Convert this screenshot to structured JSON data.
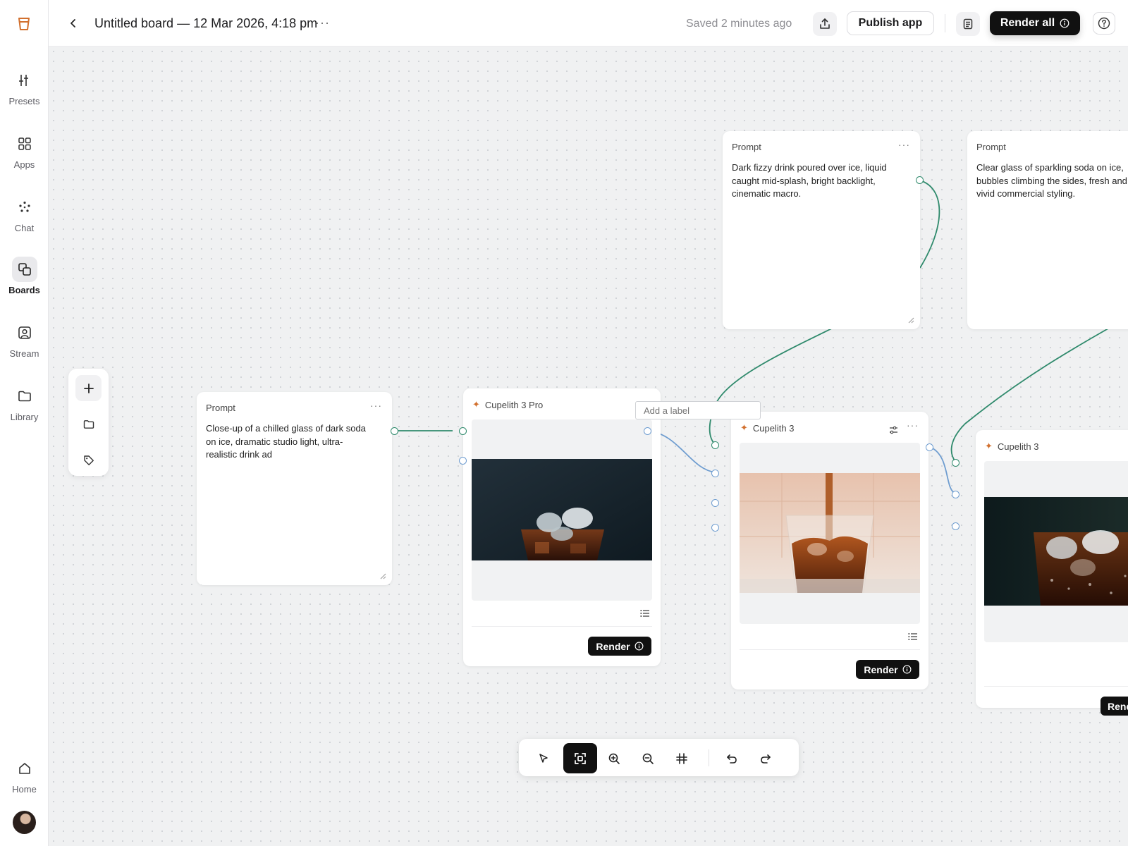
{
  "app": {
    "brand_color": "#d2702e",
    "accent_dark": "#111111",
    "wire_green": "#2f8a6c",
    "wire_blue": "#6f9dd0"
  },
  "sidebar": {
    "logo_icon": "cup-logo-icon",
    "items": [
      {
        "id": "presets",
        "label": "Presets",
        "icon": "sliders-icon",
        "active": false
      },
      {
        "id": "apps",
        "label": "Apps",
        "icon": "grid-icon",
        "active": false
      },
      {
        "id": "chat",
        "label": "Chat",
        "icon": "dots-cluster-icon",
        "active": false
      },
      {
        "id": "boards",
        "label": "Boards",
        "icon": "boards-icon",
        "active": true
      },
      {
        "id": "stream",
        "label": "Stream",
        "icon": "person-frame-icon",
        "active": false
      },
      {
        "id": "library",
        "label": "Library",
        "icon": "folder-icon",
        "active": false
      }
    ],
    "home": {
      "label": "Home",
      "icon": "home-icon"
    },
    "avatar": "user-avatar"
  },
  "header": {
    "board_title": "Untitled board — 12 Mar 2026, 4:18 pm",
    "title_menu": "···",
    "saved_status": "Saved 2 minutes ago",
    "publish_label": "Publish app",
    "render_all_label": "Render all"
  },
  "canvas": {
    "label_input": {
      "placeholder": "Add a label"
    },
    "prompt_main": {
      "header": "Prompt",
      "lines": [
        "Close-up of a chilled glass of dark soda",
        "on ice, dramatic studio light, ultra-",
        "realistic drink ad"
      ]
    },
    "prompt_top1": {
      "header": "Prompt",
      "lines": [
        "Dark fizzy drink poured over ice, liquid",
        "caught mid-splash, bright backlight,",
        "cinematic macro."
      ]
    },
    "prompt_top2": {
      "header": "Prompt",
      "lines": [
        "Clear glass of sparkling soda on ice,",
        "bubbles climbing the sides, fresh and",
        "vivid commercial styling."
      ]
    },
    "model_pro": {
      "name": "Cupelith 3 Pro",
      "render_label": "Render"
    },
    "model_mid": {
      "name": "Cupelith 3",
      "render_label": "Render"
    },
    "model_right": {
      "name": "Cupelith 3",
      "render_label": "Render"
    }
  },
  "toolbar": {
    "tools": [
      {
        "id": "select",
        "icon": "cursor-icon",
        "active": false
      },
      {
        "id": "fit",
        "icon": "focus-frame-icon",
        "active": true
      },
      {
        "id": "zoom-in",
        "icon": "zoom-in-icon",
        "active": false
      },
      {
        "id": "zoom-out",
        "icon": "zoom-out-icon",
        "active": false
      },
      {
        "id": "collapse",
        "icon": "collapse-icon",
        "active": false
      },
      {
        "id": "undo",
        "icon": "undo-icon",
        "active": false
      },
      {
        "id": "redo",
        "icon": "redo-icon",
        "active": false
      }
    ]
  }
}
